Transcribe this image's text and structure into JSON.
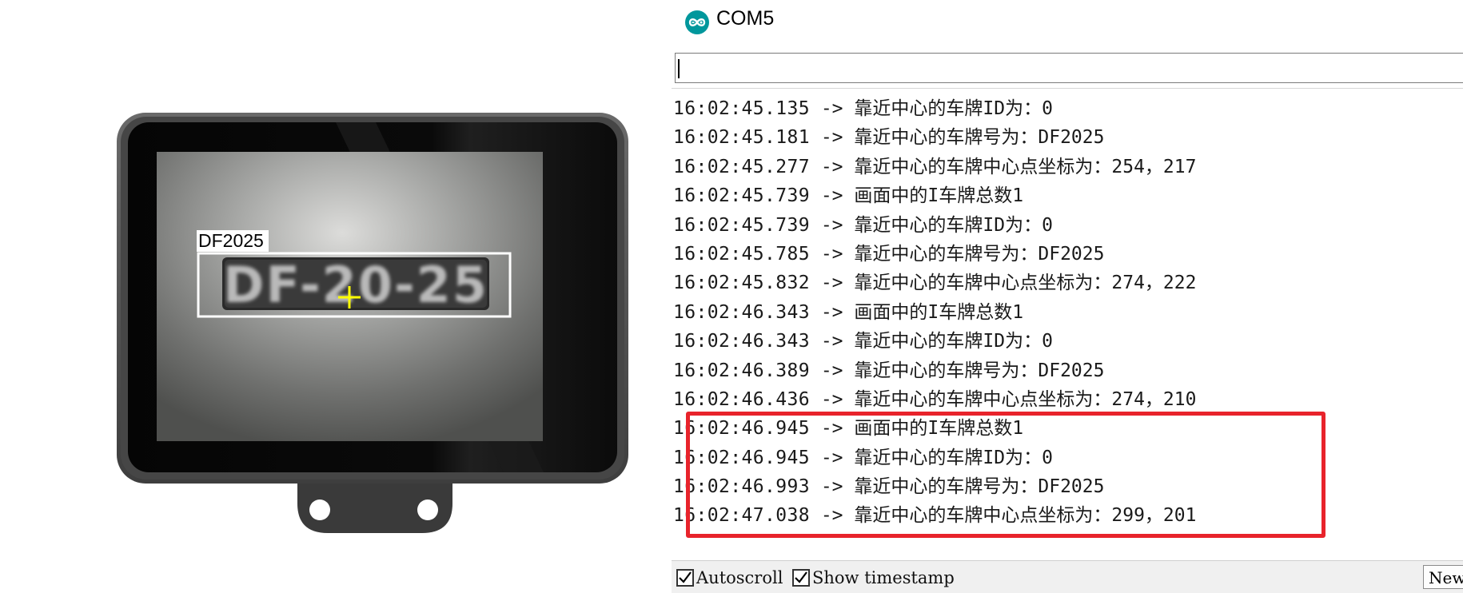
{
  "device": {
    "overlay_label": "DF2025",
    "plate_text": "DF-20-25"
  },
  "window": {
    "title": "COM5",
    "app_icon": "arduino-infinity-icon"
  },
  "send_input": {
    "value": ""
  },
  "log": [
    {
      "time": "16:02:45.135",
      "arrow": "->",
      "msg": "靠近中心的车牌ID为：0"
    },
    {
      "time": "16:02:45.181",
      "arrow": "->",
      "msg": "靠近中心的车牌号为：DF2025"
    },
    {
      "time": "16:02:45.277",
      "arrow": "->",
      "msg": "靠近中心的车牌中心点坐标为：254，217"
    },
    {
      "time": "16:02:45.739",
      "arrow": "->",
      "msg": "画面中的I车牌总数1"
    },
    {
      "time": "16:02:45.739",
      "arrow": "->",
      "msg": "靠近中心的车牌ID为：0"
    },
    {
      "time": "16:02:45.785",
      "arrow": "->",
      "msg": "靠近中心的车牌号为：DF2025"
    },
    {
      "time": "16:02:45.832",
      "arrow": "->",
      "msg": "靠近中心的车牌中心点坐标为：274，222"
    },
    {
      "time": "16:02:46.343",
      "arrow": "->",
      "msg": "画面中的I车牌总数1"
    },
    {
      "time": "16:02:46.343",
      "arrow": "->",
      "msg": "靠近中心的车牌ID为：0"
    },
    {
      "time": "16:02:46.389",
      "arrow": "->",
      "msg": "靠近中心的车牌号为：DF2025"
    },
    {
      "time": "16:02:46.436",
      "arrow": "->",
      "msg": "靠近中心的车牌中心点坐标为：274，210"
    },
    {
      "time": "16:02:46.945",
      "arrow": "->",
      "msg": "画面中的I车牌总数1"
    },
    {
      "time": "16:02:46.945",
      "arrow": "->",
      "msg": "靠近中心的车牌ID为：0"
    },
    {
      "time": "16:02:46.993",
      "arrow": "->",
      "msg": "靠近中心的车牌号为：DF2025"
    },
    {
      "time": "16:02:47.038",
      "arrow": "->",
      "msg": "靠近中心的车牌中心点坐标为：299，201"
    }
  ],
  "highlight_color": "#e8232b",
  "bottom": {
    "autoscroll_label": "Autoscroll",
    "autoscroll_checked": true,
    "timestamp_label": "Show timestamp",
    "timestamp_checked": true,
    "line_ending_value": "Newli"
  },
  "colors": {
    "arduino_teal": "#00979c",
    "detection_box": "#ffffff",
    "crosshair": "#ffff00"
  }
}
